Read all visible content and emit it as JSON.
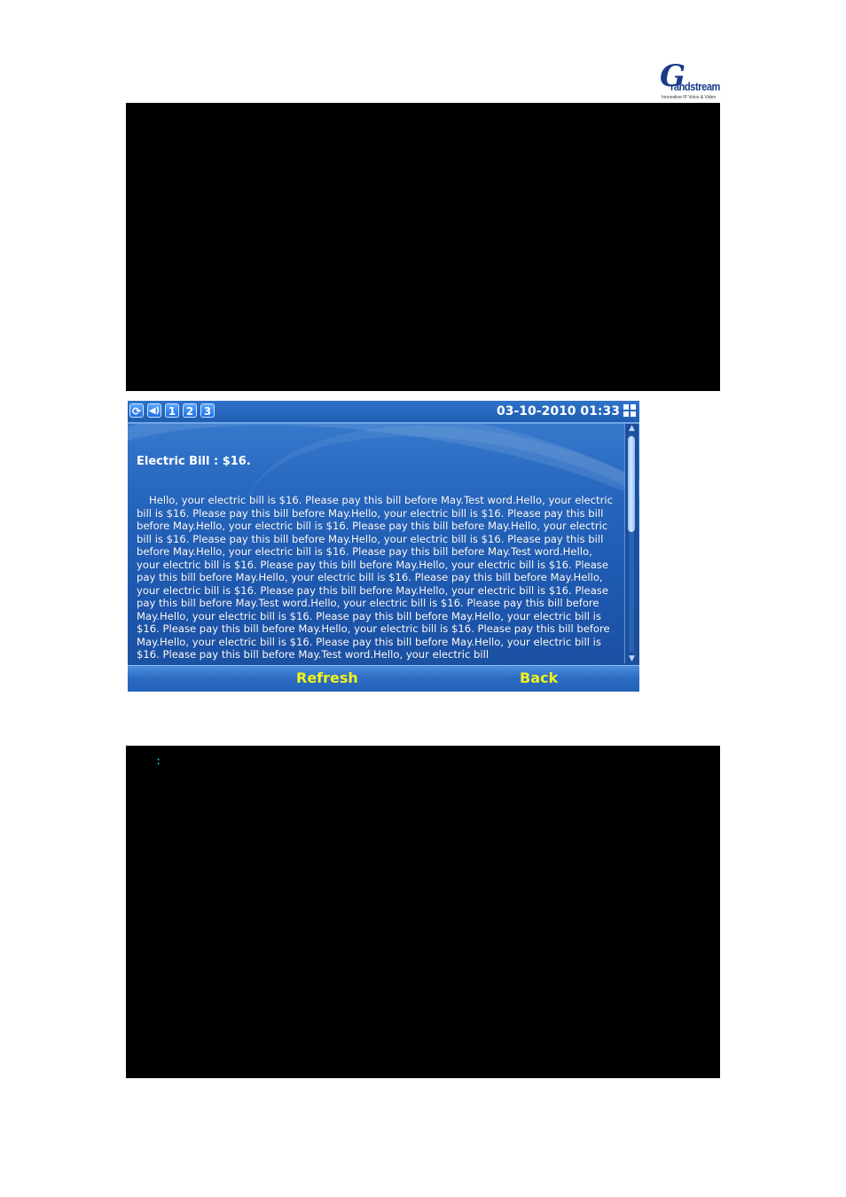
{
  "logo": {
    "letter": "G",
    "brand": "randstream",
    "tagline": "Innovative IP Voice & Video"
  },
  "bottom_panel": {
    "cursor": ":"
  },
  "status_bar": {
    "icons": [
      "refresh-icon",
      "speaker-icon",
      "account-1-icon",
      "account-2-icon",
      "account-3-icon"
    ],
    "account_labels": [
      "1",
      "2",
      "3"
    ],
    "datetime": "03-10-2010 01:33"
  },
  "message": {
    "title": "Electric Bill : $16.",
    "body": "Hello, your electric bill is $16. Please pay this bill before May.Test word.Hello, your electric bill is $16. Please pay this bill before May.Hello, your electric bill is $16. Please pay this bill before May.Hello, your electric bill is $16. Please pay this bill before May.Hello, your electric bill is $16. Please pay this bill before May.Hello, your electric bill is $16. Please pay this bill before May.Hello, your electric bill is $16. Please pay this bill before May.Test word.Hello, your electric bill is $16. Please pay this bill before May.Hello, your electric bill is $16. Please pay this bill before May.Hello, your electric bill is $16. Please pay this bill before May.Hello, your electric bill is $16. Please pay this bill before May.Hello, your electric bill is $16. Please pay this bill before May.Test word.Hello, your electric bill is $16. Please pay this bill before May.Hello, your electric bill is $16. Please pay this bill before May.Hello, your electric bill is $16. Please pay this bill before May.Hello, your electric bill is $16. Please pay this bill before May.Hello, your electric bill is $16. Please pay this bill before May.Hello, your electric bill is $16. Please pay this bill before May.Test word.Hello, your electric bill"
  },
  "softkeys": {
    "left": "Refresh",
    "right": "Back"
  },
  "colors": {
    "softkey_text": "#f3f31a",
    "screen_bg": "#2565bd",
    "panel_bg": "#000000"
  }
}
